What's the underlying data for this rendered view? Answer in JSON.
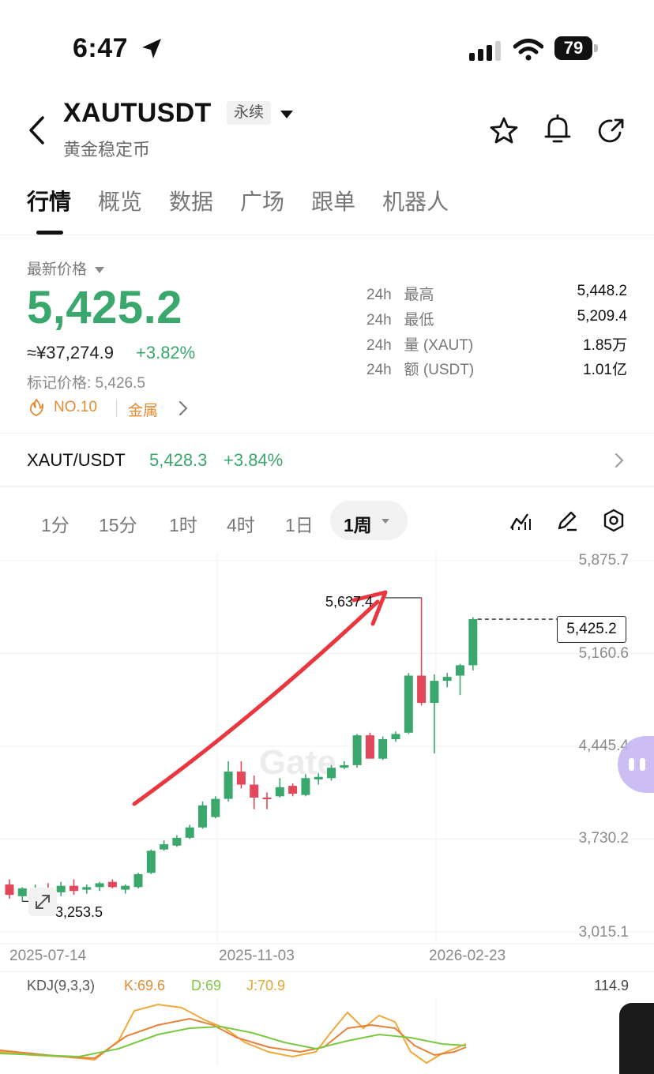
{
  "status_bar": {
    "time": "6:47",
    "battery": "79"
  },
  "header": {
    "symbol": "XAUTUSDT",
    "contract_badge": "永续",
    "subtitle": "黄金稳定币"
  },
  "tabs": [
    "行情",
    "概览",
    "数据",
    "广场",
    "跟单",
    "机器人"
  ],
  "price_panel": {
    "latest_label": "最新价格",
    "last_price": "5,425.2",
    "cny_price": "≈¥37,274.9",
    "change_pct": "+3.82%",
    "mark_price": "标记价格: 5,426.5",
    "rank": "NO.10",
    "category": "金属"
  },
  "stats": [
    {
      "period": "24h",
      "label": "最高",
      "value": "5,448.2"
    },
    {
      "period": "24h",
      "label": "最低",
      "value": "5,209.4"
    },
    {
      "period": "24h",
      "label": "量 (XAUT)",
      "value": "1.85万"
    },
    {
      "period": "24h",
      "label": "额 (USDT)",
      "value": "1.01亿"
    }
  ],
  "spot": {
    "pair": "XAUT/USDT",
    "price": "5,428.3",
    "change": "+3.84%"
  },
  "intervals": [
    "1分",
    "15分",
    "1时",
    "4时",
    "1日",
    "1周"
  ],
  "colors": {
    "up": "#3aa76d",
    "down": "#e2475a",
    "arrow": "#e8202a",
    "rank": "#e38b33"
  },
  "icons": [
    "back-icon",
    "dropdown-icon",
    "star-icon",
    "bell-icon",
    "share-icon",
    "indicator-icon",
    "draw-icon",
    "settings-icon",
    "fullscreen-icon",
    "flame-icon",
    "chevron-right-icon"
  ],
  "chart_data": {
    "type": "candlestick",
    "y_axis_ticks": [
      "5,875.7",
      "5,160.6",
      "4,445.4",
      "3,730.2",
      "3,015.1"
    ],
    "x_axis_ticks": [
      "2025-07-14",
      "2025-11-03",
      "2026-02-23"
    ],
    "ylim": [
      3015.1,
      5875.7
    ],
    "last_price_label": "5,425.2",
    "high_label": "5,637.4",
    "low_label": "3,253.5",
    "watermark": "Gate",
    "candles": [
      {
        "o": 3380,
        "h": 3420,
        "l": 3270,
        "c": 3300
      },
      {
        "o": 3290,
        "h": 3360,
        "l": 3250,
        "c": 3350
      },
      {
        "o": 3330,
        "h": 3380,
        "l": 3290,
        "c": 3350
      },
      {
        "o": 3350,
        "h": 3390,
        "l": 3300,
        "c": 3320
      },
      {
        "o": 3320,
        "h": 3400,
        "l": 3290,
        "c": 3370
      },
      {
        "o": 3370,
        "h": 3420,
        "l": 3300,
        "c": 3330
      },
      {
        "o": 3340,
        "h": 3380,
        "l": 3310,
        "c": 3360
      },
      {
        "o": 3360,
        "h": 3400,
        "l": 3330,
        "c": 3390
      },
      {
        "o": 3400,
        "h": 3420,
        "l": 3350,
        "c": 3360
      },
      {
        "o": 3340,
        "h": 3380,
        "l": 3310,
        "c": 3370
      },
      {
        "o": 3360,
        "h": 3470,
        "l": 3350,
        "c": 3460
      },
      {
        "o": 3470,
        "h": 3650,
        "l": 3460,
        "c": 3640
      },
      {
        "o": 3650,
        "h": 3720,
        "l": 3640,
        "c": 3690
      },
      {
        "o": 3680,
        "h": 3760,
        "l": 3670,
        "c": 3740
      },
      {
        "o": 3740,
        "h": 3840,
        "l": 3730,
        "c": 3820
      },
      {
        "o": 3820,
        "h": 4020,
        "l": 3810,
        "c": 3990
      },
      {
        "o": 3900,
        "h": 4060,
        "l": 3890,
        "c": 4040
      },
      {
        "o": 4040,
        "h": 4330,
        "l": 4020,
        "c": 4250
      },
      {
        "o": 4250,
        "h": 4330,
        "l": 4120,
        "c": 4150
      },
      {
        "o": 4150,
        "h": 4220,
        "l": 3960,
        "c": 4050
      },
      {
        "o": 4050,
        "h": 4090,
        "l": 3960,
        "c": 4040
      },
      {
        "o": 4060,
        "h": 4200,
        "l": 4050,
        "c": 4130
      },
      {
        "o": 4140,
        "h": 4160,
        "l": 4060,
        "c": 4080
      },
      {
        "o": 4070,
        "h": 4230,
        "l": 4060,
        "c": 4200
      },
      {
        "o": 4190,
        "h": 4240,
        "l": 4150,
        "c": 4210
      },
      {
        "o": 4200,
        "h": 4300,
        "l": 4180,
        "c": 4280
      },
      {
        "o": 4280,
        "h": 4330,
        "l": 4270,
        "c": 4300
      },
      {
        "o": 4300,
        "h": 4540,
        "l": 4280,
        "c": 4530
      },
      {
        "o": 4530,
        "h": 4550,
        "l": 4360,
        "c": 4350
      },
      {
        "o": 4350,
        "h": 4520,
        "l": 4340,
        "c": 4500
      },
      {
        "o": 4500,
        "h": 4560,
        "l": 4480,
        "c": 4540
      },
      {
        "o": 4550,
        "h": 5010,
        "l": 4540,
        "c": 4990
      },
      {
        "o": 4990,
        "h": 5590,
        "l": 4760,
        "c": 4780
      },
      {
        "o": 4780,
        "h": 5000,
        "l": 4390,
        "c": 4950
      },
      {
        "o": 4950,
        "h": 5010,
        "l": 4900,
        "c": 4980
      },
      {
        "o": 4990,
        "h": 5080,
        "l": 4840,
        "c": 5070
      },
      {
        "o": 5070,
        "h": 5440,
        "l": 5030,
        "c": 5425
      }
    ]
  },
  "kdj": {
    "label": "KDJ(9,3,3)",
    "k": "K:69.6",
    "d": "D:69",
    "j": "J:70.9",
    "axis_top": "114.9"
  }
}
